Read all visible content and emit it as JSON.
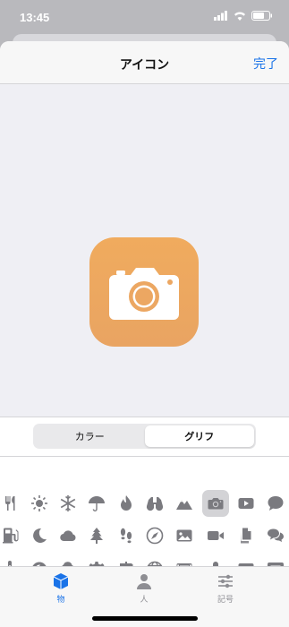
{
  "status": {
    "time": "13:45"
  },
  "nav": {
    "title": "アイコン",
    "done_label": "完了"
  },
  "preview": {
    "icon": "camera-icon",
    "color": "#ef aa60"
  },
  "segment": {
    "options": [
      "カラー",
      "グリフ"
    ],
    "selected": "グリフ"
  },
  "glyphs": {
    "rows": [
      [
        "fork-knife-icon",
        "sun-icon",
        "snowflake-icon",
        "umbrella-icon",
        "flame-icon",
        "binoculars-icon",
        "mountain-icon",
        "camera-icon",
        "play-icon",
        "speech-bubble-icon"
      ],
      [
        "gas-pump-icon",
        "moon-icon",
        "cloud-icon",
        "tree-icon",
        "footprints-icon",
        "compass-icon",
        "photo-icon",
        "video-icon",
        "documents-icon",
        "chat-bubbles-icon"
      ],
      [
        "thermometer-icon",
        "moon-circle-icon",
        "cloud-rain-icon",
        "gear-icon",
        "signpost-icon",
        "globe-icon",
        "film-icon",
        "microphone-icon",
        "calendar-icon",
        "message-lines-icon"
      ]
    ],
    "selected": "camera-icon"
  },
  "tabs": [
    {
      "label": "物",
      "icon": "cube-icon",
      "active": true
    },
    {
      "label": "人",
      "icon": "person-icon",
      "active": false
    },
    {
      "label": "記号",
      "icon": "sliders-icon",
      "active": false
    }
  ]
}
